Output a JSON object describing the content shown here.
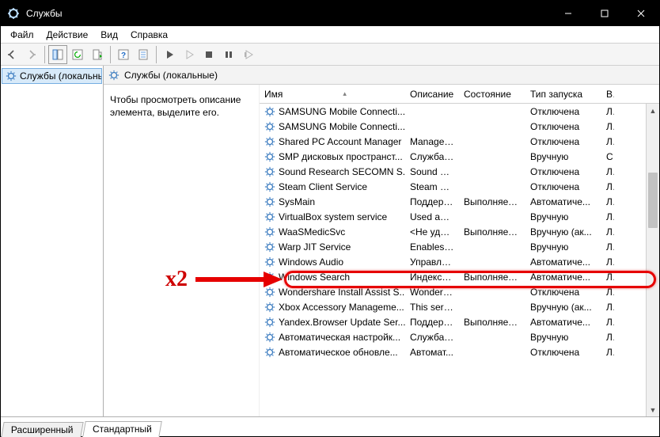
{
  "title": "Службы",
  "menu": {
    "file": "Файл",
    "action": "Действие",
    "view": "Вид",
    "help": "Справка"
  },
  "tree": {
    "root": "Службы (локальные)"
  },
  "rightHeader": "Службы (локальные)",
  "descPane": "Чтобы просмотреть описание элемента, выделите его.",
  "columns": {
    "name": "Имя",
    "desc": "Описание",
    "state": "Состояние",
    "start": "Тип запуска",
    "acct": "В"
  },
  "tabs": {
    "ext": "Расширенный",
    "std": "Стандартный"
  },
  "annotation": "x2",
  "services": [
    {
      "name": "SAMSUNG Mobile Connecti...",
      "desc": "",
      "state": "",
      "start": "Отключена",
      "acct": "Л"
    },
    {
      "name": "SAMSUNG Mobile Connecti...",
      "desc": "",
      "state": "",
      "start": "Отключена",
      "acct": "Л"
    },
    {
      "name": "Shared PC Account Manager",
      "desc": "Manages ...",
      "state": "",
      "start": "Отключена",
      "acct": "Л"
    },
    {
      "name": "SMP дисковых пространст...",
      "desc": "Служба ...",
      "state": "",
      "start": "Вручную",
      "acct": "С"
    },
    {
      "name": "Sound Research SECOMN S...",
      "desc": "Sound Re...",
      "state": "",
      "start": "Отключена",
      "acct": "Л"
    },
    {
      "name": "Steam Client Service",
      "desc": "Steam Cli...",
      "state": "",
      "start": "Отключена",
      "acct": "Л"
    },
    {
      "name": "SysMain",
      "desc": "Поддерж...",
      "state": "Выполняется",
      "start": "Автоматиче...",
      "acct": "Л"
    },
    {
      "name": "VirtualBox system service",
      "desc": "Used as a...",
      "state": "",
      "start": "Вручную",
      "acct": "Л"
    },
    {
      "name": "WaaSMedicSvc",
      "desc": "<Не удае...",
      "state": "Выполняется",
      "start": "Вручную (ак...",
      "acct": "Л"
    },
    {
      "name": "Warp JIT Service",
      "desc": "Enables JI...",
      "state": "",
      "start": "Вручную",
      "acct": "Л"
    },
    {
      "name": "Windows Audio",
      "desc": "Управле...",
      "state": "",
      "start": "Автоматиче...",
      "acct": "Л"
    },
    {
      "name": "Windows Search",
      "desc": "Индекси...",
      "state": "Выполняется",
      "start": "Автоматиче...",
      "acct": "Л"
    },
    {
      "name": "Wondershare Install Assist S...",
      "desc": "Wonders...",
      "state": "",
      "start": "Отключена",
      "acct": "Л"
    },
    {
      "name": "Xbox Accessory Manageme...",
      "desc": "This servi...",
      "state": "",
      "start": "Вручную (ак...",
      "acct": "Л"
    },
    {
      "name": "Yandex.Browser Update Ser...",
      "desc": "Поддерж...",
      "state": "Выполняется",
      "start": "Автоматиче...",
      "acct": "Л"
    },
    {
      "name": "Автоматическая настройк...",
      "desc": "Служба ...",
      "state": "",
      "start": "Вручную",
      "acct": "Л"
    },
    {
      "name": "Автоматическое обновле...",
      "desc": "Автомат...",
      "state": "",
      "start": "Отключена",
      "acct": "Л"
    }
  ]
}
